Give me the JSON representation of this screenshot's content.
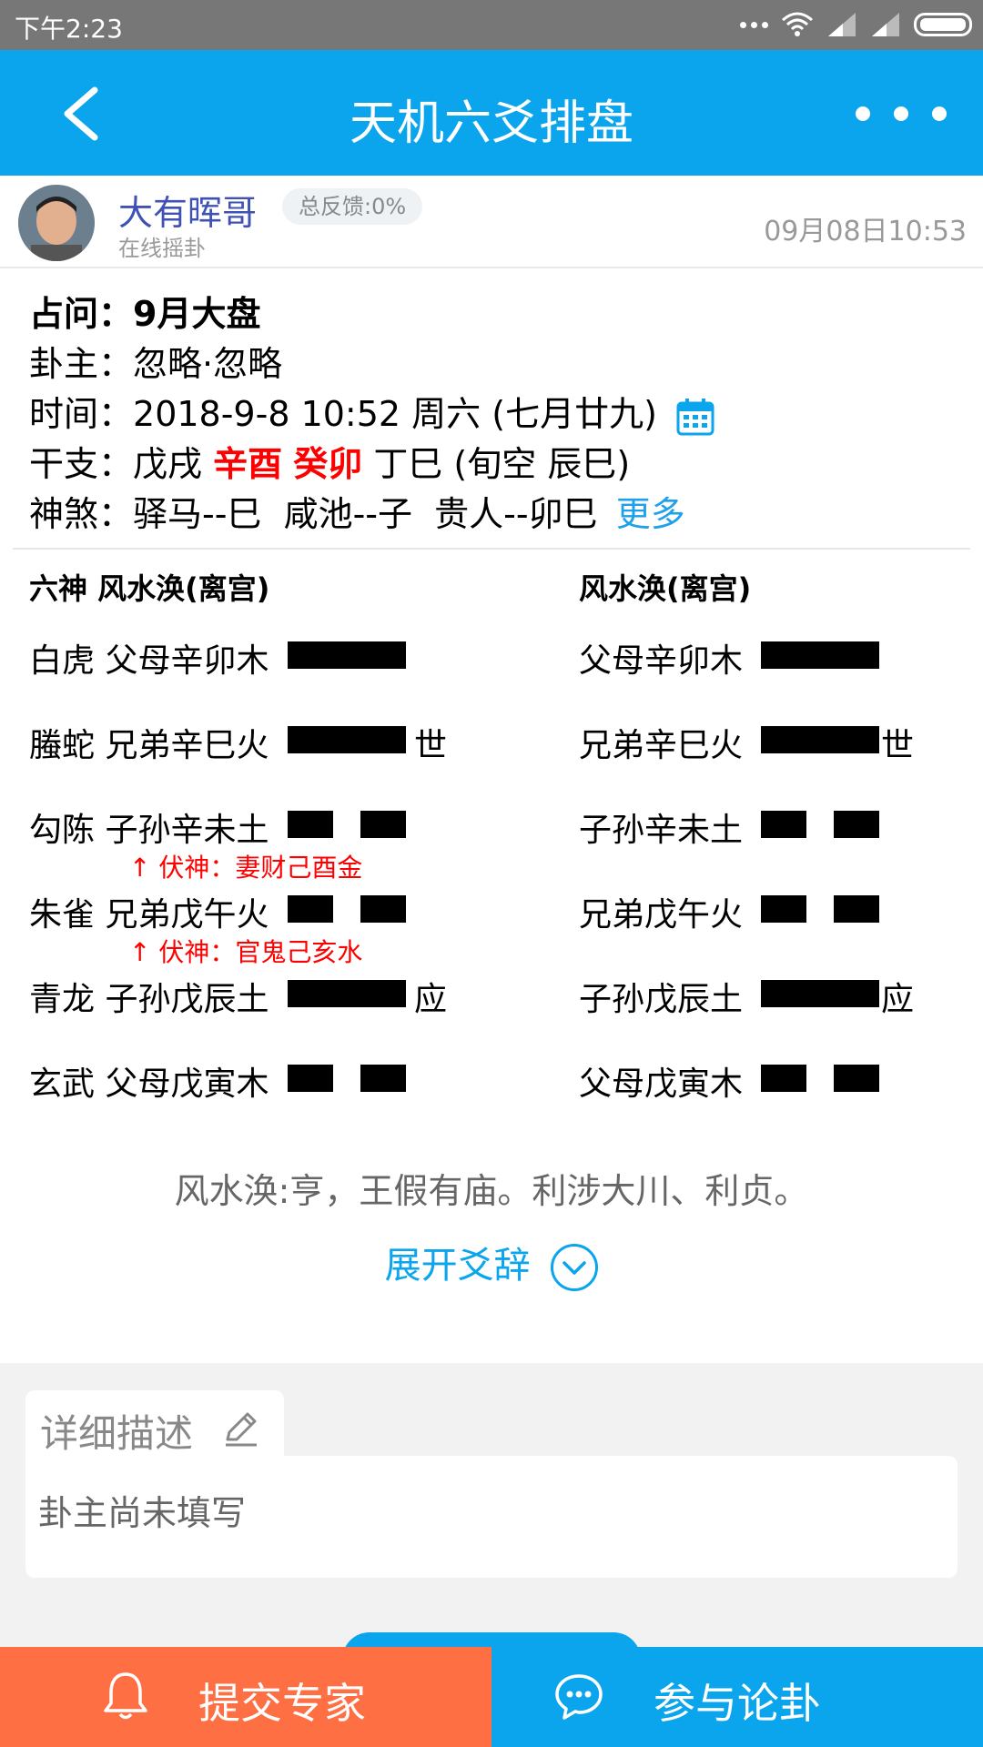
{
  "status_bar": {
    "time": "下午2:23"
  },
  "app_bar": {
    "title": "天机六爻排盘"
  },
  "user": {
    "name": "大有晖哥",
    "feedback": "总反馈:0%",
    "subtitle": "在线摇卦",
    "datetime": "09月08日10:53"
  },
  "info": {
    "question_label": "占问：",
    "question_value": "9月大盘",
    "owner_label": "卦主：",
    "owner_value": "忽略·忽略",
    "time_label": "时间：",
    "time_value": "2018-9-8 10:52 周六 (七月廿九)",
    "ganzhi_label": "干支：",
    "ganzhi_1": "戊戌",
    "ganzhi_2": "辛酉",
    "ganzhi_3": "癸卯",
    "ganzhi_4": "丁巳 (旬空 辰巳)",
    "shensha_label": "神煞：",
    "shensha_value": "驿马--巳  咸池--子  贵人--卯巳",
    "shensha_more": "更多"
  },
  "hexagram": {
    "left_header": "六神 风水涣(离宫)",
    "right_header": "风水涣(离宫)",
    "left_lines": [
      {
        "text": "白虎 父母辛卯木",
        "line_type": "yang",
        "mark": ""
      },
      {
        "text": "螣蛇 兄弟辛巳火",
        "line_type": "yang",
        "mark": "世"
      },
      {
        "text": "勾陈 子孙辛未土",
        "line_type": "yin",
        "mark": ""
      },
      {
        "text": "朱雀 兄弟戊午火",
        "line_type": "yin",
        "mark": ""
      },
      {
        "text": "青龙 子孙戊辰土",
        "line_type": "yang",
        "mark": "应"
      },
      {
        "text": "玄武 父母戊寅木",
        "line_type": "yin",
        "mark": ""
      }
    ],
    "right_lines": [
      {
        "text": "父母辛卯木",
        "line_type": "yang",
        "mark": ""
      },
      {
        "text": "兄弟辛巳火",
        "line_type": "yang",
        "mark": "世"
      },
      {
        "text": "子孙辛未土",
        "line_type": "yin",
        "mark": ""
      },
      {
        "text": "兄弟戊午火",
        "line_type": "yin",
        "mark": ""
      },
      {
        "text": "子孙戊辰土",
        "line_type": "yang",
        "mark": "应"
      },
      {
        "text": "父母戊寅木",
        "line_type": "yin",
        "mark": ""
      }
    ],
    "fushen_1": "↑ 伏神：妻财己酉金",
    "fushen_2": "↑ 伏神：官鬼己亥水",
    "guaci": "风水涣:亨，王假有庙。利涉大川、利贞。",
    "expand_label": "展开爻辞"
  },
  "description": {
    "tab_label": "详细描述",
    "content": "卦主尚未填写"
  },
  "bottom": {
    "left_label": "提交专家",
    "right_label": "参与论卦"
  },
  "colors": {
    "primary": "#0aa5ec",
    "accent_orange": "#ff6f44",
    "highlight_red": "#ff0000"
  }
}
